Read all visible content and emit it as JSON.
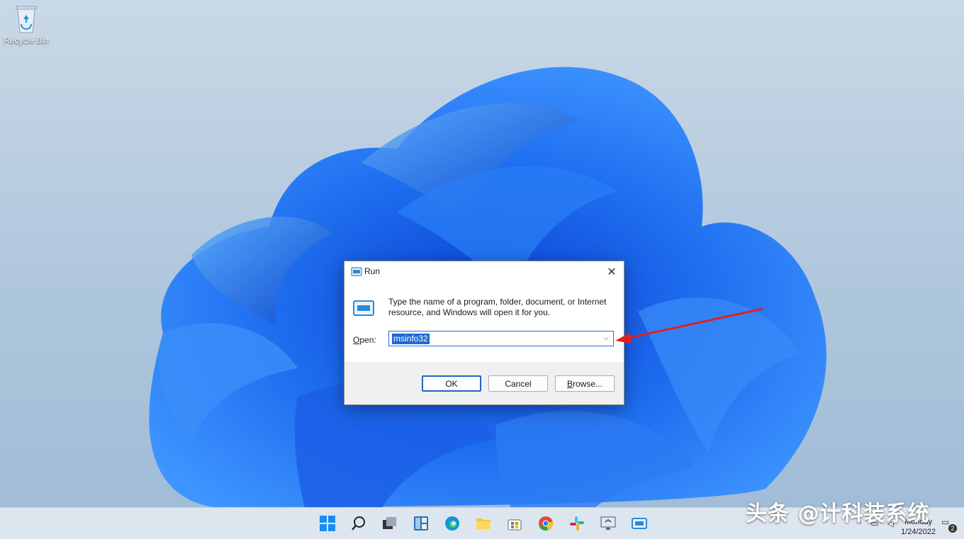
{
  "desktop": {
    "icons": [
      {
        "label": "Recycle Bin",
        "icon": "recycle-bin-icon"
      }
    ]
  },
  "run_dialog": {
    "title": "Run",
    "title_icon": "run-icon",
    "description": "Type the name of a program, folder, document, or Internet resource, and Windows will open it for you.",
    "open_label_prefix": "",
    "open_label_underlined": "O",
    "open_label_rest": "pen:",
    "input_value": "msinfo32",
    "ok_label": "OK",
    "cancel_label": "Cancel",
    "browse_label_underlined": "B",
    "browse_label_rest": "rowse..."
  },
  "taskbar": {
    "icons": [
      "start-icon",
      "search-icon",
      "task-view-icon",
      "widgets-icon",
      "edge-icon",
      "file-explorer-icon",
      "store-icon",
      "chrome-icon",
      "slack-icon",
      "remote-desktop-icon",
      "run-icon"
    ],
    "clock_day": "Monday",
    "clock_date": "1/24/2022",
    "notification_count": "2"
  },
  "watermark": "头条 @计科装系统",
  "colors": {
    "accent": "#1c6ad6",
    "arrow": "#e02020",
    "dialog_bg": "#f0f0f0"
  }
}
